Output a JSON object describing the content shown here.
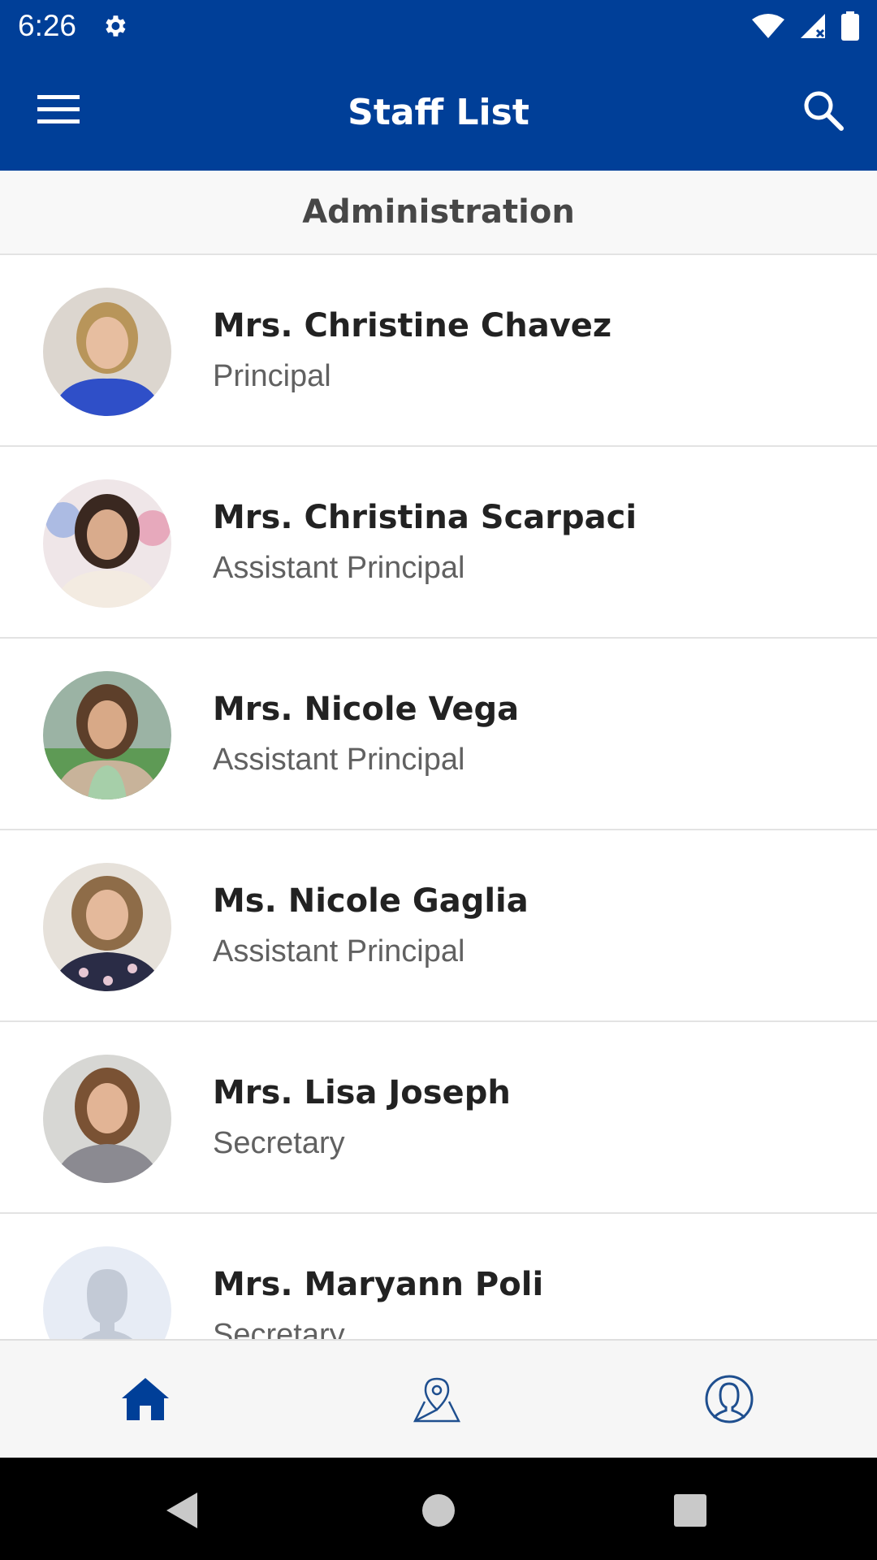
{
  "status_bar": {
    "time": "6:26",
    "icons": [
      "gear-icon",
      "wifi-icon",
      "signal-icon",
      "battery-icon"
    ]
  },
  "app_bar": {
    "title": "Staff List",
    "left_icon": "menu-icon",
    "right_icon": "search-icon",
    "background": "#003F98"
  },
  "section": {
    "title": "Administration"
  },
  "staff": [
    {
      "name": "Mrs. Christine Chavez",
      "role": "Principal"
    },
    {
      "name": "Mrs. Christina Scarpaci",
      "role": "Assistant Principal"
    },
    {
      "name": "Mrs. Nicole Vega",
      "role": "Assistant Principal"
    },
    {
      "name": "Ms. Nicole Gaglia",
      "role": "Assistant Principal"
    },
    {
      "name": "Mrs. Lisa Joseph",
      "role": "Secretary"
    },
    {
      "name": "Mrs. Maryann Poli",
      "role": "Secretary"
    }
  ],
  "bottom_tabs": [
    {
      "icon": "home-icon",
      "active": true
    },
    {
      "icon": "map-pin-icon",
      "active": false
    },
    {
      "icon": "profile-icon",
      "active": false
    }
  ],
  "colors": {
    "accent": "#003F98",
    "tab_active": "#003F98",
    "tab_inactive": "#1f4f8f"
  }
}
